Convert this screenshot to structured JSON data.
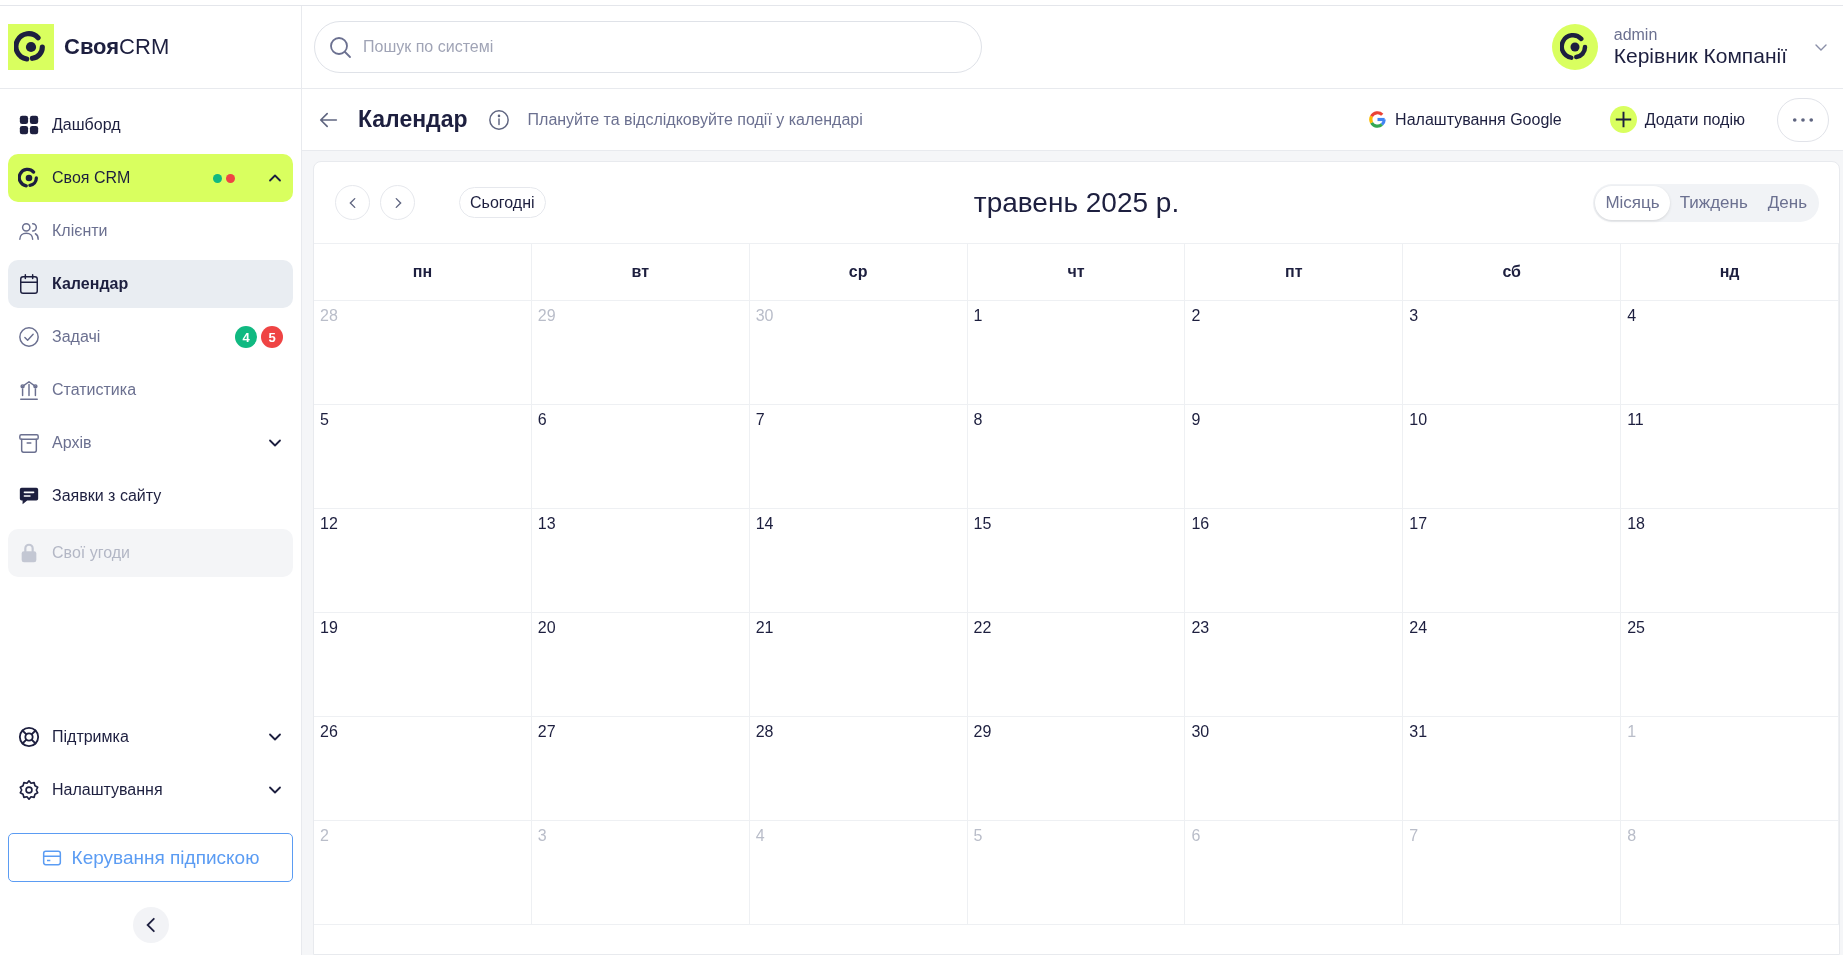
{
  "sidebar": {
    "logo": "**Своя**CRM",
    "items": [
      {
        "kind": "link",
        "label": "Дашборд"
      },
      {
        "kind": "group",
        "label": "Своя CRM",
        "expanded": true,
        "dots": [
          {
            "color": "#10b981"
          },
          {
            "color": "#ef4444"
          }
        ],
        "children": [
          {
            "kind": "link",
            "label": "Клієнти",
            "selected": false
          },
          {
            "kind": "link",
            "label": "Календар",
            "selected": true
          },
          {
            "kind": "link",
            "label": "Задачі",
            "selected": false,
            "badges": [
              {
                "text": "4",
                "color": "#10b981"
              },
              {
                "text": "5",
                "color": "#ef4444"
              }
            ]
          },
          {
            "kind": "link",
            "label": "Статистика",
            "selected": false
          },
          {
            "kind": "group",
            "label": "Архів",
            "selected": false,
            "expanded": false
          }
        ]
      },
      {
        "kind": "link",
        "label": "Заявки з сайту"
      },
      {
        "kind": "locked",
        "label": "Свої угоди"
      }
    ],
    "footer_items": [
      {
        "kind": "group",
        "label": "Підтримка",
        "expanded": false
      },
      {
        "kind": "group",
        "label": "Налаштування",
        "expanded": false
      }
    ],
    "subscription_button": "Керування підпискою"
  },
  "header": {
    "search": {
      "placeholder": "Пошук по системі"
    },
    "user": {
      "name": "admin",
      "role": "Керівник Компанії"
    }
  },
  "page_header": {
    "title": "Календар",
    "subtitle": "Плануйте та відслідковуйте події у календарі",
    "google_button": "Налаштування Google",
    "add_button": "Додати подію"
  },
  "calendar": {
    "today_button": "Сьогодні",
    "title": "травень 2025 р.",
    "views": [
      {
        "label": "Місяць",
        "selected": true
      },
      {
        "label": "Тиждень",
        "selected": false
      },
      {
        "label": "День",
        "selected": false
      }
    ],
    "weekdays": [
      "пн",
      "вт",
      "ср",
      "чт",
      "пт",
      "сб",
      "нд"
    ],
    "weeks": [
      [
        {
          "label": "28",
          "in_month": false
        },
        {
          "label": "29",
          "in_month": false
        },
        {
          "label": "30",
          "in_month": false
        },
        {
          "label": "1",
          "in_month": true
        },
        {
          "label": "2",
          "in_month": true
        },
        {
          "label": "3",
          "in_month": true
        },
        {
          "label": "4",
          "in_month": true
        }
      ],
      [
        {
          "label": "5",
          "in_month": true
        },
        {
          "label": "6",
          "in_month": true
        },
        {
          "label": "7",
          "in_month": true
        },
        {
          "label": "8",
          "in_month": true
        },
        {
          "label": "9",
          "in_month": true
        },
        {
          "label": "10",
          "in_month": true
        },
        {
          "label": "11",
          "in_month": true
        }
      ],
      [
        {
          "label": "12",
          "in_month": true
        },
        {
          "label": "13",
          "in_month": true
        },
        {
          "label": "14",
          "in_month": true
        },
        {
          "label": "15",
          "in_month": true
        },
        {
          "label": "16",
          "in_month": true
        },
        {
          "label": "17",
          "in_month": true
        },
        {
          "label": "18",
          "in_month": true
        }
      ],
      [
        {
          "label": "19",
          "in_month": true
        },
        {
          "label": "20",
          "in_month": true
        },
        {
          "label": "21",
          "in_month": true
        },
        {
          "label": "22",
          "in_month": true
        },
        {
          "label": "23",
          "in_month": true
        },
        {
          "label": "24",
          "in_month": true
        },
        {
          "label": "25",
          "in_month": true
        }
      ],
      [
        {
          "label": "26",
          "in_month": true
        },
        {
          "label": "27",
          "in_month": true
        },
        {
          "label": "28",
          "in_month": true
        },
        {
          "label": "29",
          "in_month": true
        },
        {
          "label": "30",
          "in_month": true
        },
        {
          "label": "31",
          "in_month": true
        },
        {
          "label": "1",
          "in_month": false
        }
      ],
      [
        {
          "label": "2",
          "in_month": false
        },
        {
          "label": "3",
          "in_month": false
        },
        {
          "label": "4",
          "in_month": false
        },
        {
          "label": "5",
          "in_month": false
        },
        {
          "label": "6",
          "in_month": false
        },
        {
          "label": "7",
          "in_month": false
        },
        {
          "label": "8",
          "in_month": false
        }
      ]
    ]
  }
}
